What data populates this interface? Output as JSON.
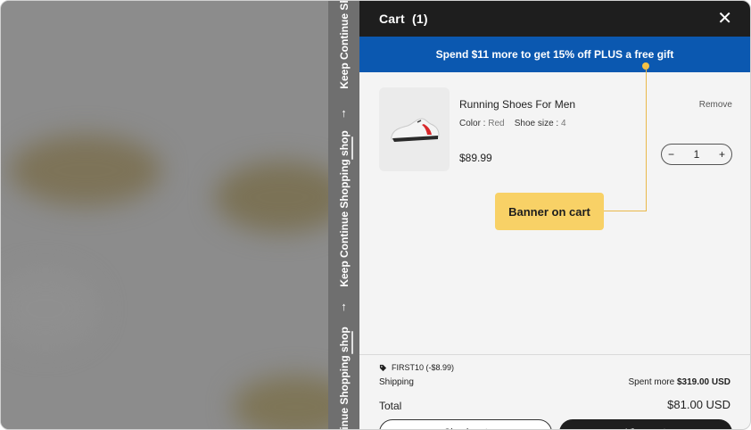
{
  "strip": {
    "label": "Keep Continue Shopping shop",
    "top_label": "Keep Continue Sh",
    "bottom_label": "tinue Shopping shop",
    "arrow": "↑"
  },
  "cart": {
    "title": "Cart",
    "count": "(1)",
    "close_icon": "✕",
    "banner": "Spend $11 more to get 15% off PLUS a free gift"
  },
  "item": {
    "name": "Running Shoes For Men",
    "color_label": "Color :",
    "color_value": "Red",
    "size_label": "Shoe size :",
    "size_value": "4",
    "price": "$89.99",
    "remove_label": "Remove",
    "quantity": "1",
    "minus": "−",
    "plus": "+"
  },
  "annotation": {
    "label": "Banner on cart"
  },
  "summary": {
    "coupon": "FIRST10 (-$8.99)",
    "shipping_label": "Shipping",
    "shipping_prefix": "Spent more",
    "shipping_amount": "$319.00 USD",
    "total_label": "Total",
    "total_value": "$81.00 USD",
    "btn_left": "Check out",
    "btn_right": "View cart"
  },
  "colors": {
    "header": "#1e1e1e",
    "banner": "#0b58b0",
    "callout": "#f8d166"
  }
}
